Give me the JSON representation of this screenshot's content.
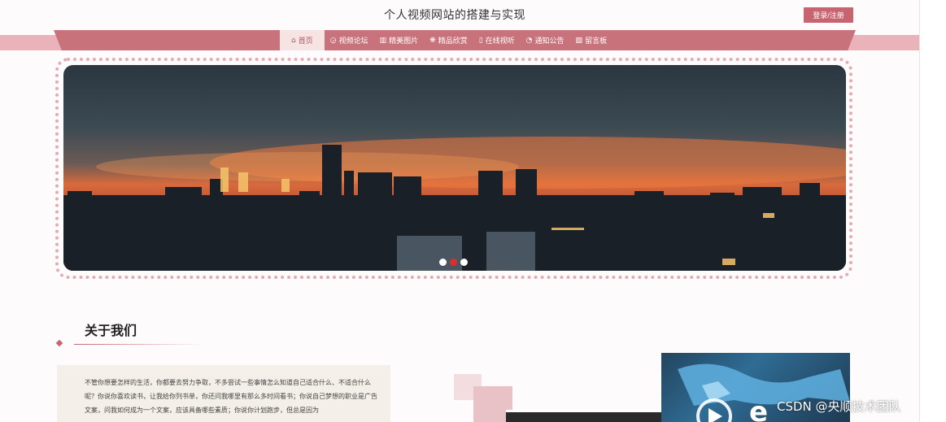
{
  "header": {
    "site_title": "个人视频网站的搭建与实现",
    "login_label": "登录/注册"
  },
  "nav": {
    "items": [
      {
        "icon": "⌂",
        "label": "首页",
        "active": true
      },
      {
        "icon": "◶",
        "label": "视频论坛"
      },
      {
        "icon": "▥",
        "label": "精美图片"
      },
      {
        "icon": "❋",
        "label": "精品欣赏"
      },
      {
        "icon": "▯",
        "label": "在线视听"
      },
      {
        "icon": "◔",
        "label": "通知公告"
      },
      {
        "icon": "▧",
        "label": "留言板"
      }
    ]
  },
  "banner": {
    "slide_count": 3,
    "active_slide": 2
  },
  "about": {
    "title": "关于我们",
    "text": "不管你想要怎样的生活，你都要去努力争取，不多尝试一些事情怎么知道自己适合什么、不适合什么呢？你说你喜欢读书，让我给你列书单，你还问我哪里有那么多时间看书；你说自己梦想的职业是广告文案，问我如何成为一个文案，应该具备哪些素质；你说你计划跑步，但总是因为"
  },
  "watermark": "CSDN @央顺技术团队",
  "colors": {
    "accent": "#c8646f",
    "nav_bar": "#c8727b",
    "nav_band": "#e9b3b9",
    "active_dot": "#d9302f"
  }
}
